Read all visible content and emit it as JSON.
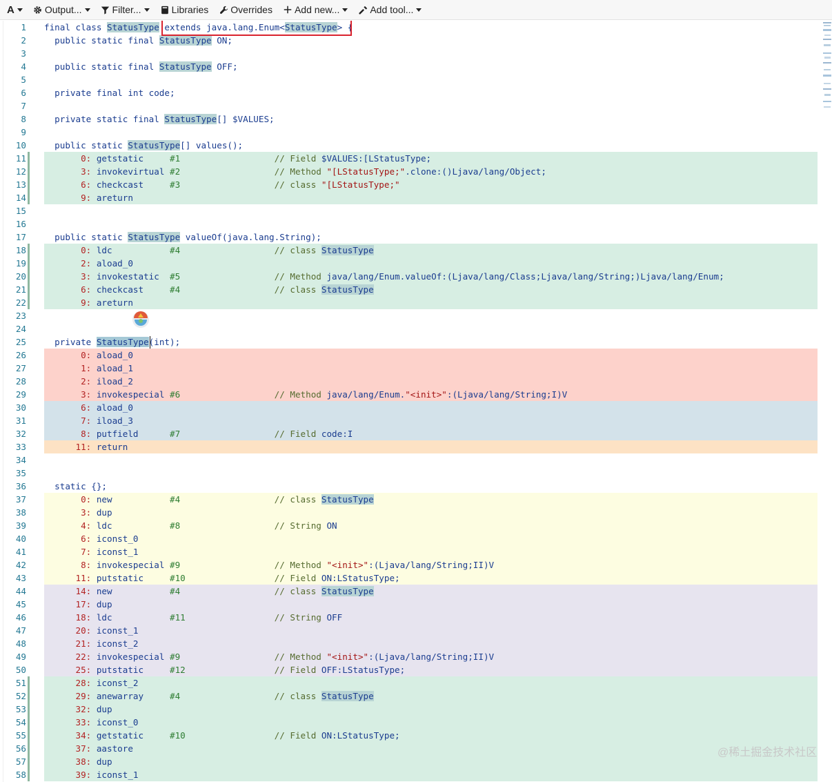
{
  "toolbar": {
    "font_label": "A",
    "output_label": "Output...",
    "filter_label": "Filter...",
    "libraries_label": "Libraries",
    "overrides_label": "Overrides",
    "add_new_label": "Add new...",
    "add_tool_label": "Add tool..."
  },
  "colors": {
    "green": "#d7eee3",
    "red": "#fdd2cb",
    "blue": "#d3e2ea",
    "orange": "#fde2c4",
    "yellow": "#fdfde1",
    "lavender": "#e7e4ef",
    "marker": "#8fb8a0"
  },
  "watermark": "@稀土掘金技术社区",
  "lines": [
    {
      "n": "1",
      "hl": "",
      "code": [
        [
          "kw",
          "final class "
        ],
        [
          "type",
          "StatusType"
        ],
        [
          "plain",
          " "
        ],
        [
          "kw",
          "extends java.lang.Enum<"
        ],
        [
          "type",
          "StatusType"
        ],
        [
          "kw",
          "> {"
        ]
      ]
    },
    {
      "n": "2",
      "hl": "",
      "code": [
        [
          "kw",
          "  public static final "
        ],
        [
          "type",
          "StatusType"
        ],
        [
          "kw",
          " ON;"
        ]
      ]
    },
    {
      "n": "3",
      "hl": "",
      "code": []
    },
    {
      "n": "4",
      "hl": "",
      "code": [
        [
          "kw",
          "  public static final "
        ],
        [
          "type",
          "StatusType"
        ],
        [
          "kw",
          " OFF;"
        ]
      ]
    },
    {
      "n": "5",
      "hl": "",
      "code": []
    },
    {
      "n": "6",
      "hl": "",
      "code": [
        [
          "kw",
          "  private final int code;"
        ]
      ]
    },
    {
      "n": "7",
      "hl": "",
      "code": []
    },
    {
      "n": "8",
      "hl": "",
      "code": [
        [
          "kw",
          "  private static final "
        ],
        [
          "type",
          "StatusType"
        ],
        [
          "kw",
          "[] $VALUES;"
        ]
      ]
    },
    {
      "n": "9",
      "hl": "",
      "code": []
    },
    {
      "n": "10",
      "hl": "",
      "code": [
        [
          "kw",
          "  public static "
        ],
        [
          "type",
          "StatusType"
        ],
        [
          "kw",
          "[] values();"
        ]
      ]
    },
    {
      "n": "11",
      "hl": "green",
      "code": [
        [
          "ofs",
          "       0: "
        ],
        [
          "op",
          "getstatic     "
        ],
        [
          "arg",
          "#1 "
        ],
        [
          "plain",
          "                 "
        ],
        [
          "cmt",
          "// Field "
        ],
        [
          "cmt-b",
          "$VALUES:[LStatusType;"
        ]
      ]
    },
    {
      "n": "12",
      "hl": "green",
      "code": [
        [
          "ofs",
          "       3: "
        ],
        [
          "op",
          "invokevirtual "
        ],
        [
          "arg",
          "#2 "
        ],
        [
          "plain",
          "                 "
        ],
        [
          "cmt",
          "// Method "
        ],
        [
          "str",
          "\"[LStatusType;\""
        ],
        [
          "cmt-b",
          ".clone:()Ljava/lang/Object;"
        ]
      ]
    },
    {
      "n": "13",
      "hl": "green",
      "code": [
        [
          "ofs",
          "       6: "
        ],
        [
          "op",
          "checkcast     "
        ],
        [
          "arg",
          "#3 "
        ],
        [
          "plain",
          "                 "
        ],
        [
          "cmt",
          "// class "
        ],
        [
          "str",
          "\"[LStatusType;\""
        ]
      ]
    },
    {
      "n": "14",
      "hl": "green",
      "code": [
        [
          "ofs",
          "       9: "
        ],
        [
          "op",
          "areturn"
        ]
      ]
    },
    {
      "n": "15",
      "hl": "",
      "code": []
    },
    {
      "n": "16",
      "hl": "",
      "code": []
    },
    {
      "n": "17",
      "hl": "",
      "code": [
        [
          "kw",
          "  public static "
        ],
        [
          "type",
          "StatusType"
        ],
        [
          "kw",
          " valueOf(java.lang.String);"
        ]
      ]
    },
    {
      "n": "18",
      "hl": "green",
      "code": [
        [
          "ofs",
          "       0: "
        ],
        [
          "op",
          "ldc           "
        ],
        [
          "arg",
          "#4 "
        ],
        [
          "plain",
          "                 "
        ],
        [
          "cmt",
          "// class "
        ],
        [
          "type",
          "StatusType"
        ]
      ]
    },
    {
      "n": "19",
      "hl": "green",
      "code": [
        [
          "ofs",
          "       2: "
        ],
        [
          "op",
          "aload_0"
        ]
      ]
    },
    {
      "n": "20",
      "hl": "green",
      "code": [
        [
          "ofs",
          "       3: "
        ],
        [
          "op",
          "invokestatic  "
        ],
        [
          "arg",
          "#5 "
        ],
        [
          "plain",
          "                 "
        ],
        [
          "cmt",
          "// Method "
        ],
        [
          "cmt-b",
          "java/lang/Enum.valueOf:(Ljava/lang/Class;Ljava/lang/String;)Ljava/lang/Enum;"
        ]
      ]
    },
    {
      "n": "21",
      "hl": "green",
      "code": [
        [
          "ofs",
          "       6: "
        ],
        [
          "op",
          "checkcast     "
        ],
        [
          "arg",
          "#4 "
        ],
        [
          "plain",
          "                 "
        ],
        [
          "cmt",
          "// class "
        ],
        [
          "type",
          "StatusType"
        ]
      ]
    },
    {
      "n": "22",
      "hl": "green",
      "code": [
        [
          "ofs",
          "       9: "
        ],
        [
          "op",
          "areturn"
        ]
      ]
    },
    {
      "n": "23",
      "hl": "",
      "code": []
    },
    {
      "n": "24",
      "hl": "",
      "code": []
    },
    {
      "n": "25",
      "hl": "",
      "code": [
        [
          "kw",
          "  private "
        ],
        [
          "type-sel",
          "StatusType"
        ],
        [
          "kw",
          "(int);"
        ]
      ]
    },
    {
      "n": "26",
      "hl": "red",
      "code": [
        [
          "ofs",
          "       0: "
        ],
        [
          "op",
          "aload_0"
        ]
      ]
    },
    {
      "n": "27",
      "hl": "red",
      "code": [
        [
          "ofs",
          "       1: "
        ],
        [
          "op",
          "aload_1"
        ]
      ]
    },
    {
      "n": "28",
      "hl": "red",
      "code": [
        [
          "ofs",
          "       2: "
        ],
        [
          "op",
          "iload_2"
        ]
      ]
    },
    {
      "n": "29",
      "hl": "red",
      "code": [
        [
          "ofs",
          "       3: "
        ],
        [
          "op",
          "invokespecial "
        ],
        [
          "arg",
          "#6 "
        ],
        [
          "plain",
          "                 "
        ],
        [
          "cmt",
          "// Method "
        ],
        [
          "cmt-b",
          "java/lang/Enum."
        ],
        [
          "str",
          "\"<init>\""
        ],
        [
          "cmt-b",
          ":(Ljava/lang/String;I)V"
        ]
      ]
    },
    {
      "n": "30",
      "hl": "blue",
      "code": [
        [
          "ofs",
          "       6: "
        ],
        [
          "op",
          "aload_0"
        ]
      ]
    },
    {
      "n": "31",
      "hl": "blue",
      "code": [
        [
          "ofs",
          "       7: "
        ],
        [
          "op",
          "iload_3"
        ]
      ]
    },
    {
      "n": "32",
      "hl": "blue",
      "code": [
        [
          "ofs",
          "       8: "
        ],
        [
          "op",
          "putfield      "
        ],
        [
          "arg",
          "#7 "
        ],
        [
          "plain",
          "                 "
        ],
        [
          "cmt",
          "// Field "
        ],
        [
          "cmt-b",
          "code:I"
        ]
      ]
    },
    {
      "n": "33",
      "hl": "orange",
      "code": [
        [
          "ofs",
          "      11: "
        ],
        [
          "op",
          "return"
        ]
      ]
    },
    {
      "n": "34",
      "hl": "",
      "code": []
    },
    {
      "n": "35",
      "hl": "",
      "code": []
    },
    {
      "n": "36",
      "hl": "",
      "code": [
        [
          "kw",
          "  static {};"
        ]
      ]
    },
    {
      "n": "37",
      "hl": "yellow",
      "code": [
        [
          "ofs",
          "       0: "
        ],
        [
          "op",
          "new           "
        ],
        [
          "arg",
          "#4 "
        ],
        [
          "plain",
          "                 "
        ],
        [
          "cmt",
          "// class "
        ],
        [
          "type",
          "StatusType"
        ]
      ]
    },
    {
      "n": "38",
      "hl": "yellow",
      "code": [
        [
          "ofs",
          "       3: "
        ],
        [
          "op",
          "dup"
        ]
      ]
    },
    {
      "n": "39",
      "hl": "yellow",
      "code": [
        [
          "ofs",
          "       4: "
        ],
        [
          "op",
          "ldc           "
        ],
        [
          "arg",
          "#8 "
        ],
        [
          "plain",
          "                 "
        ],
        [
          "cmt",
          "// String "
        ],
        [
          "cmt-b",
          "ON"
        ]
      ]
    },
    {
      "n": "40",
      "hl": "yellow",
      "code": [
        [
          "ofs",
          "       6: "
        ],
        [
          "op",
          "iconst_0"
        ]
      ]
    },
    {
      "n": "41",
      "hl": "yellow",
      "code": [
        [
          "ofs",
          "       7: "
        ],
        [
          "op",
          "iconst_1"
        ]
      ]
    },
    {
      "n": "42",
      "hl": "yellow",
      "code": [
        [
          "ofs",
          "       8: "
        ],
        [
          "op",
          "invokespecial "
        ],
        [
          "arg",
          "#9 "
        ],
        [
          "plain",
          "                 "
        ],
        [
          "cmt",
          "// Method "
        ],
        [
          "str",
          "\"<init>\""
        ],
        [
          "cmt-b",
          ":(Ljava/lang/String;II)V"
        ]
      ]
    },
    {
      "n": "43",
      "hl": "yellow",
      "code": [
        [
          "ofs",
          "      11: "
        ],
        [
          "op",
          "putstatic     "
        ],
        [
          "arg",
          "#10"
        ],
        [
          "plain",
          "                 "
        ],
        [
          "cmt",
          "// Field "
        ],
        [
          "cmt-b",
          "ON:LStatusType;"
        ]
      ]
    },
    {
      "n": "44",
      "hl": "lavender",
      "code": [
        [
          "ofs",
          "      14: "
        ],
        [
          "op",
          "new           "
        ],
        [
          "arg",
          "#4 "
        ],
        [
          "plain",
          "                 "
        ],
        [
          "cmt",
          "// class "
        ],
        [
          "type",
          "StatusType"
        ]
      ]
    },
    {
      "n": "45",
      "hl": "lavender",
      "code": [
        [
          "ofs",
          "      17: "
        ],
        [
          "op",
          "dup"
        ]
      ]
    },
    {
      "n": "46",
      "hl": "lavender",
      "code": [
        [
          "ofs",
          "      18: "
        ],
        [
          "op",
          "ldc           "
        ],
        [
          "arg",
          "#11"
        ],
        [
          "plain",
          "                 "
        ],
        [
          "cmt",
          "// String "
        ],
        [
          "cmt-b",
          "OFF"
        ]
      ]
    },
    {
      "n": "47",
      "hl": "lavender",
      "code": [
        [
          "ofs",
          "      20: "
        ],
        [
          "op",
          "iconst_1"
        ]
      ]
    },
    {
      "n": "48",
      "hl": "lavender",
      "code": [
        [
          "ofs",
          "      21: "
        ],
        [
          "op",
          "iconst_2"
        ]
      ]
    },
    {
      "n": "49",
      "hl": "lavender",
      "code": [
        [
          "ofs",
          "      22: "
        ],
        [
          "op",
          "invokespecial "
        ],
        [
          "arg",
          "#9 "
        ],
        [
          "plain",
          "                 "
        ],
        [
          "cmt",
          "// Method "
        ],
        [
          "str",
          "\"<init>\""
        ],
        [
          "cmt-b",
          ":(Ljava/lang/String;II)V"
        ]
      ]
    },
    {
      "n": "50",
      "hl": "lavender",
      "code": [
        [
          "ofs",
          "      25: "
        ],
        [
          "op",
          "putstatic     "
        ],
        [
          "arg",
          "#12"
        ],
        [
          "plain",
          "                 "
        ],
        [
          "cmt",
          "// Field "
        ],
        [
          "cmt-b",
          "OFF:LStatusType;"
        ]
      ]
    },
    {
      "n": "51",
      "hl": "green",
      "code": [
        [
          "ofs",
          "      28: "
        ],
        [
          "op",
          "iconst_2"
        ]
      ]
    },
    {
      "n": "52",
      "hl": "green",
      "code": [
        [
          "ofs",
          "      29: "
        ],
        [
          "op",
          "anewarray     "
        ],
        [
          "arg",
          "#4 "
        ],
        [
          "plain",
          "                 "
        ],
        [
          "cmt",
          "// class "
        ],
        [
          "type",
          "StatusType"
        ]
      ]
    },
    {
      "n": "53",
      "hl": "green",
      "code": [
        [
          "ofs",
          "      32: "
        ],
        [
          "op",
          "dup"
        ]
      ]
    },
    {
      "n": "54",
      "hl": "green",
      "code": [
        [
          "ofs",
          "      33: "
        ],
        [
          "op",
          "iconst_0"
        ]
      ]
    },
    {
      "n": "55",
      "hl": "green",
      "code": [
        [
          "ofs",
          "      34: "
        ],
        [
          "op",
          "getstatic     "
        ],
        [
          "arg",
          "#10"
        ],
        [
          "plain",
          "                 "
        ],
        [
          "cmt",
          "// Field "
        ],
        [
          "cmt-b",
          "ON:LStatusType;"
        ]
      ]
    },
    {
      "n": "56",
      "hl": "green",
      "code": [
        [
          "ofs",
          "      37: "
        ],
        [
          "op",
          "aastore"
        ]
      ]
    },
    {
      "n": "57",
      "hl": "green",
      "code": [
        [
          "ofs",
          "      38: "
        ],
        [
          "op",
          "dup"
        ]
      ]
    },
    {
      "n": "58",
      "hl": "green",
      "code": [
        [
          "ofs",
          "      39: "
        ],
        [
          "op",
          "iconst_1"
        ]
      ]
    }
  ]
}
